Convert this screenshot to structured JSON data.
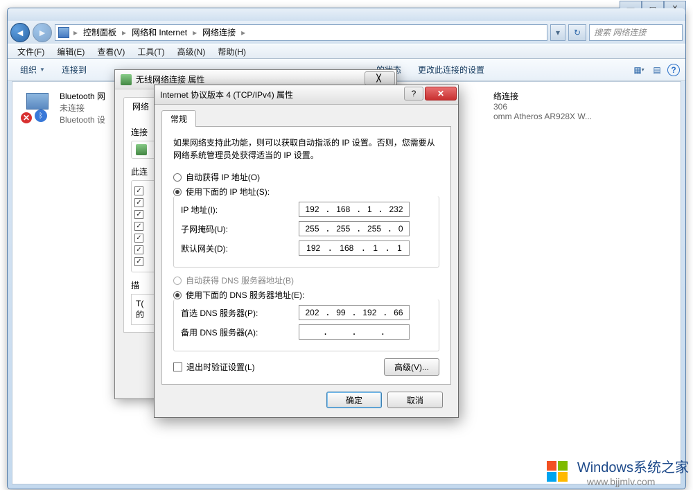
{
  "window": {
    "breadcrumb": [
      "控制面板",
      "网络和 Internet",
      "网络连接"
    ],
    "search_placeholder": "搜索 网络连接",
    "min_glyph": "—",
    "max_glyph": "▭",
    "close_glyph": "✕"
  },
  "menu": [
    "文件(F)",
    "编辑(E)",
    "查看(V)",
    "工具(T)",
    "高级(N)",
    "帮助(H)"
  ],
  "toolbar": {
    "organize": "组织",
    "connect_to": "连接到",
    "status": "的状态",
    "change_settings": "更改此连接的设置",
    "help_glyph": "?"
  },
  "connections": {
    "bt": {
      "title": "Bluetooth 网",
      "status": "未连接",
      "desc": "Bluetooth 设"
    },
    "wifi": {
      "title": "络连接",
      "status": "306",
      "desc": "omm Atheros AR928X W..."
    }
  },
  "dlg1": {
    "title": "无线网络连接 属性",
    "close_glyph": "╳",
    "tab": "网络",
    "connect_label": "连接",
    "list_label": "此连",
    "checks": [
      "",
      "",
      "",
      "",
      "",
      "",
      ""
    ],
    "desc_label": "描",
    "desc_lines": [
      "T(",
      "的"
    ]
  },
  "dlg2": {
    "title": "Internet 协议版本 4 (TCP/IPv4) 属性",
    "help_glyph": "?",
    "close_glyph": "✕",
    "tab": "常规",
    "hint": "如果网络支持此功能，则可以获取自动指派的 IP 设置。否则，您需要从网络系统管理员处获得适当的 IP 设置。",
    "radio_auto_ip": "自动获得 IP 地址(O)",
    "radio_manual_ip": "使用下面的 IP 地址(S):",
    "ip_label": "IP 地址(I):",
    "ip_value": [
      "192",
      "168",
      "1",
      "232"
    ],
    "mask_label": "子网掩码(U):",
    "mask_value": [
      "255",
      "255",
      "255",
      "0"
    ],
    "gw_label": "默认网关(D):",
    "gw_value": [
      "192",
      "168",
      "1",
      "1"
    ],
    "radio_auto_dns": "自动获得 DNS 服务器地址(B)",
    "radio_manual_dns": "使用下面的 DNS 服务器地址(E):",
    "dns1_label": "首选 DNS 服务器(P):",
    "dns1_value": [
      "202",
      "99",
      "192",
      "66"
    ],
    "dns2_label": "备用 DNS 服务器(A):",
    "dns2_value": [
      "",
      "",
      "",
      ""
    ],
    "validate_label": "退出时验证设置(L)",
    "advanced": "高级(V)...",
    "ok": "确定",
    "cancel": "取消"
  },
  "watermark": {
    "brand": "Windows",
    "brand2": "系统之家",
    "url": "www.bjjmlv.com"
  }
}
